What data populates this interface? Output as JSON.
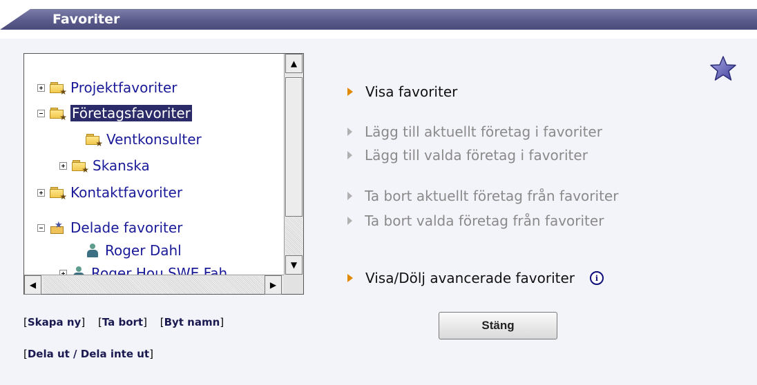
{
  "header": {
    "title": "Favoriter"
  },
  "tree": {
    "nodes": [
      {
        "label": "Projektfavoriter"
      },
      {
        "label": "Företagsfavoriter"
      },
      {
        "label": "Ventkonsulter"
      },
      {
        "label": "Skanska"
      },
      {
        "label": "Kontaktfavoriter"
      },
      {
        "label": "Delade favoriter"
      },
      {
        "label": "Roger Dahl"
      },
      {
        "label": "Roger Hou SWE Fah"
      }
    ]
  },
  "links": {
    "create": "Skapa ny",
    "delete": "Ta bort",
    "rename": "Byt namn",
    "share": "Dela ut / Dela inte ut"
  },
  "actions": {
    "show": "Visa favoriter",
    "add_current": "Lägg till aktuellt företag i favoriter",
    "add_selected": "Lägg till valda företag i favoriter",
    "remove_current": "Ta bort aktuellt företag från favoriter",
    "remove_selected": "Ta bort valda företag från favoriter",
    "toggle_advanced": "Visa/Dölj avancerade favoriter"
  },
  "close_label": "Stäng",
  "icons": [
    "folder-star-icon",
    "person-icon",
    "shared-folder-icon",
    "info-icon",
    "star-icon"
  ],
  "colors": {
    "header": "#5c5c8c",
    "accent_arrow": "#e08a00",
    "link": "#1a1a99",
    "selection": "#2b2b69"
  }
}
